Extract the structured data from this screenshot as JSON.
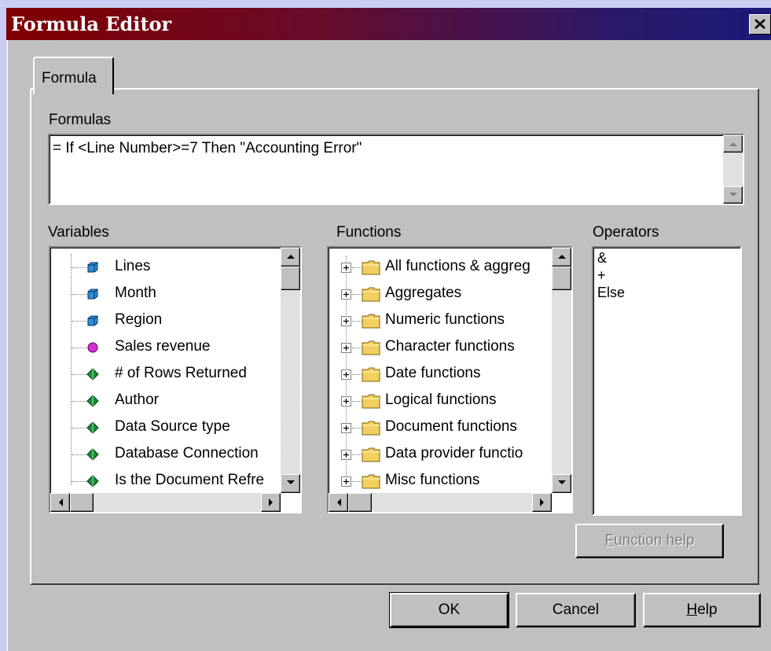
{
  "window": {
    "title": "Formula Editor"
  },
  "tabs": [
    {
      "label": "Formula"
    }
  ],
  "formulas": {
    "label": "Formulas",
    "value": "= If <Line Number>=7 Then \"Accounting Error\""
  },
  "variables": {
    "label": "Variables",
    "items": [
      {
        "label": "Lines",
        "icon": "dimension-cube-icon"
      },
      {
        "label": "Month",
        "icon": "dimension-cube-icon"
      },
      {
        "label": "Region",
        "icon": "dimension-cube-icon"
      },
      {
        "label": "Sales revenue",
        "icon": "measure-circle-icon"
      },
      {
        "label": "# of Rows Returned",
        "icon": "variable-diamond-icon"
      },
      {
        "label": "Author",
        "icon": "variable-diamond-icon"
      },
      {
        "label": "Data Source type",
        "icon": "variable-diamond-icon"
      },
      {
        "label": "Database Connection",
        "icon": "variable-diamond-icon"
      },
      {
        "label": "Is the Document Refre",
        "icon": "variable-diamond-icon"
      }
    ]
  },
  "functions": {
    "label": "Functions",
    "items": [
      {
        "label": "All functions & aggreg"
      },
      {
        "label": "Aggregates"
      },
      {
        "label": "Numeric functions"
      },
      {
        "label": "Character functions"
      },
      {
        "label": "Date functions"
      },
      {
        "label": "Logical functions"
      },
      {
        "label": "Document functions"
      },
      {
        "label": "Data provider functio"
      },
      {
        "label": "Misc functions"
      }
    ]
  },
  "operators": {
    "label": "Operators",
    "items": [
      {
        "label": "&"
      },
      {
        "label": "+"
      },
      {
        "label": "Else"
      }
    ]
  },
  "buttons": {
    "function_help": {
      "label": "Function help",
      "mnemonic": "F",
      "rest": "unction help"
    },
    "ok": {
      "label": "OK"
    },
    "cancel": {
      "label": "Cancel"
    },
    "help": {
      "label": "Help",
      "mnemonic": "H",
      "rest": "elp"
    }
  },
  "colors": {
    "title_gradient_start": "#800000",
    "title_gradient_end": "#1a1a78",
    "dimension_icon": "#2f8fd8",
    "measure_icon": "#d030d0",
    "variable_icon": "#1a8a3a",
    "folder_icon": "#f0d060"
  }
}
